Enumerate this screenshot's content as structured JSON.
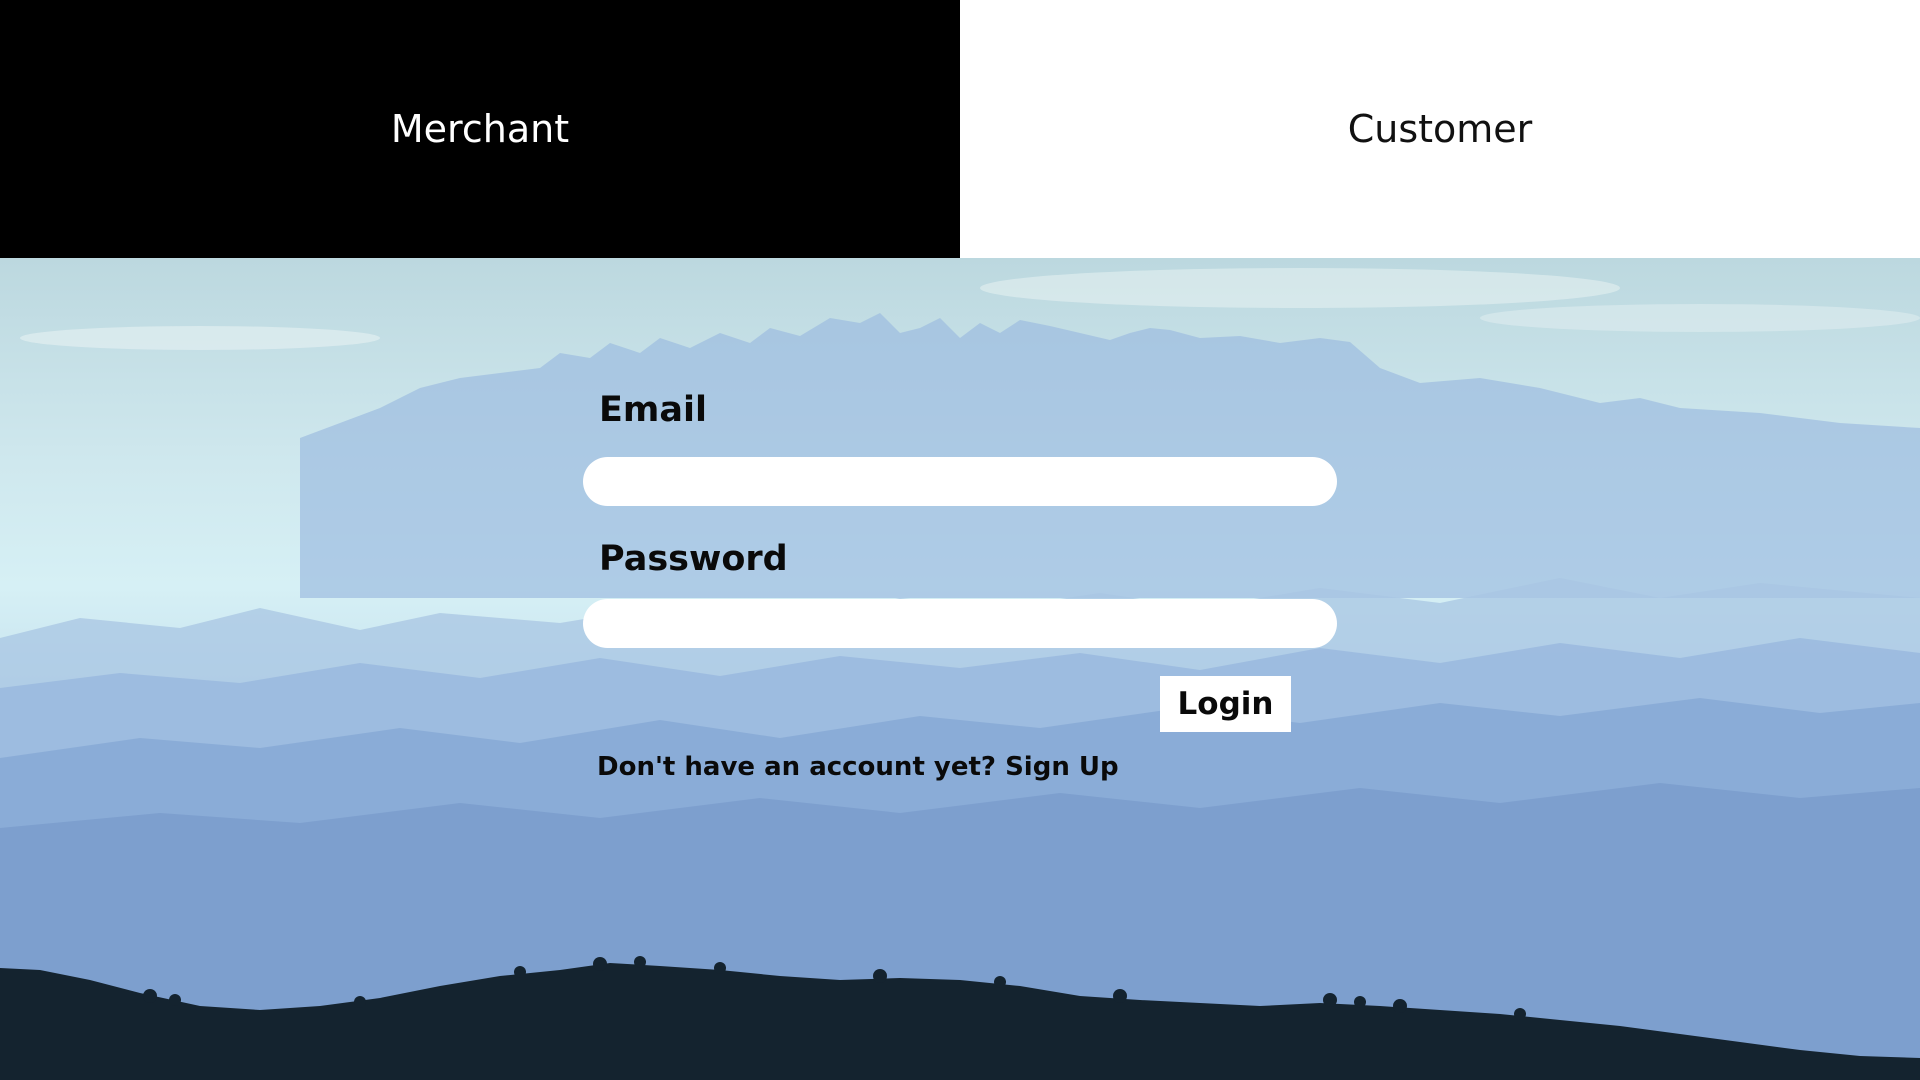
{
  "tabs": {
    "merchant_label": "Merchant",
    "customer_label": "Customer"
  },
  "form": {
    "email_label": "Email",
    "email_value": "",
    "password_label": "Password",
    "password_value": "",
    "login_label": "Login",
    "signup_prompt": "Don't have an account yet?",
    "signup_link": "Sign Up"
  },
  "colors": {
    "merchant_tab_bg": "#000000",
    "customer_tab_bg": "#ffffff",
    "forest_silhouette": "#14232f",
    "sky": "#cfe8ee",
    "far_mountains": "#8fb0dc"
  }
}
